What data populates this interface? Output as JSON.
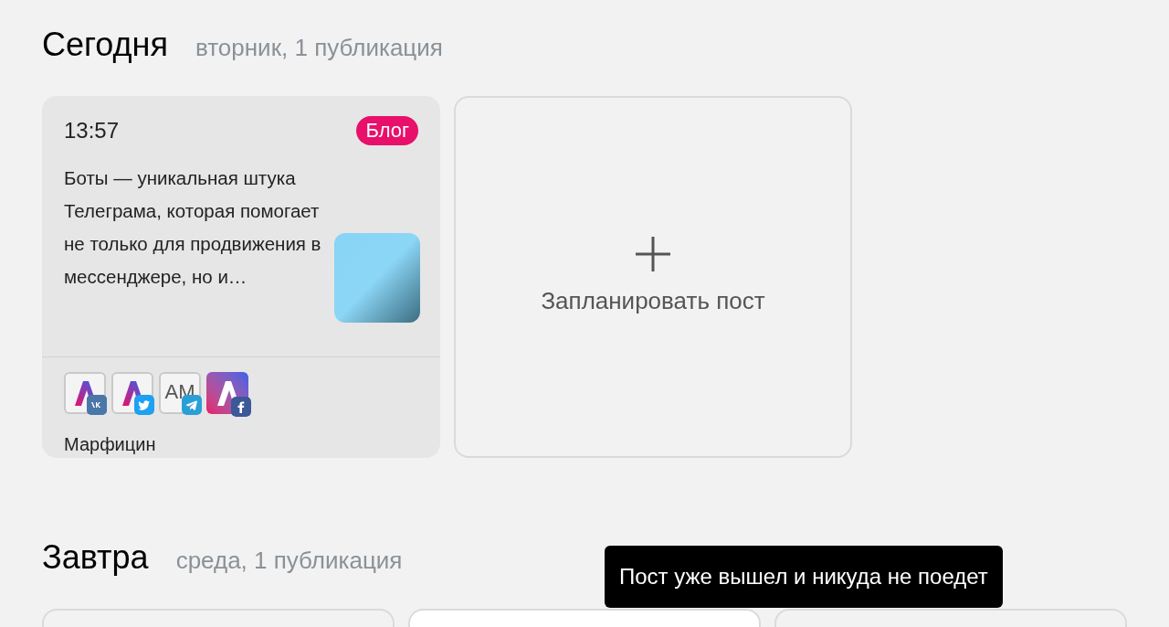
{
  "sections": [
    {
      "title": "Сегодня",
      "subtitle": "вторник, 1 публикация",
      "posts": [
        {
          "kind": "full",
          "time": "13:57",
          "tag": {
            "label": "Блог",
            "color": "#e8106a"
          },
          "text": "Боты — уникальная штука Телеграма, которая помогает не только для продвижения в мессенджере, но и…",
          "channels": [
            {
              "kind": "logo",
              "badge": {
                "kind": "vk"
              }
            },
            {
              "kind": "logo",
              "badge": {
                "kind": "twitter"
              }
            },
            {
              "kind": "text",
              "text": "AM",
              "badge": {
                "kind": "telegram"
              }
            },
            {
              "kind": "filled",
              "badge": {
                "kind": "facebook"
              }
            }
          ],
          "author": "Марфицин"
        },
        {
          "kind": "add",
          "label": "Запланировать пост"
        }
      ]
    },
    {
      "title": "Завтра",
      "subtitle": "среда, 1 публикация",
      "posts": [
        {
          "kind": "cut"
        },
        {
          "kind": "cut_white"
        },
        {
          "kind": "cut"
        }
      ]
    }
  ],
  "tooltip": {
    "text": "Пост уже вышел и никуда не поедет"
  }
}
